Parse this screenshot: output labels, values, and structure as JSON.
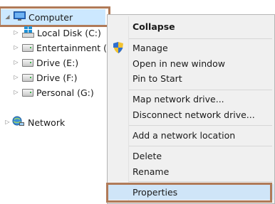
{
  "tree": {
    "computer": "Computer",
    "drives": [
      {
        "label": "Local Disk (C:)"
      },
      {
        "label": "Entertainment (D:)"
      },
      {
        "label": "Drive (E:)"
      },
      {
        "label": "Drive (F:)"
      },
      {
        "label": "Personal (G:)"
      }
    ],
    "network": "Network"
  },
  "menu": {
    "collapse": "Collapse",
    "manage": "Manage",
    "open_new_window": "Open in new window",
    "pin_to_start": "Pin to Start",
    "map_network_drive": "Map network drive...",
    "disconnect_network_drive": "Disconnect network drive...",
    "add_network_location": "Add a network location",
    "delete": "Delete",
    "rename": "Rename",
    "properties": "Properties"
  },
  "colors": {
    "selection": "#cce8ff",
    "highlight_border": "#b07a58",
    "menu_background": "#f0f0f0"
  }
}
